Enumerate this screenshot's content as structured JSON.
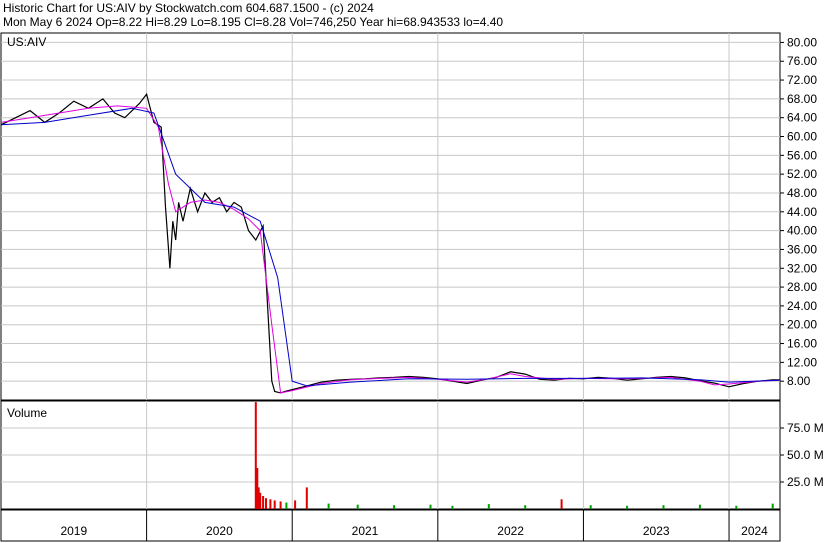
{
  "header": {
    "line1": "Historic Chart for US:AIV by Stockwatch.com 604.687.1500 - (c) 2024",
    "line2": "Mon May  6 2024   Op=8.22  Hi=8.29  Lo=8.195  Cl=8.28  Vol=746,250  Year hi=68.943533  lo=4.40"
  },
  "colors": {
    "price": "#000000",
    "ma_short": "#e000e0",
    "ma_long": "#0000cc",
    "volume_up": "#00a000",
    "volume_down": "#e00000",
    "grid": "#c8c8c8"
  },
  "chart_data": [
    {
      "type": "line",
      "label": "US:AIV",
      "y_ticks": [
        "80.00",
        "76.00",
        "72.00",
        "68.00",
        "64.00",
        "60.00",
        "56.00",
        "52.00",
        "48.00",
        "44.00",
        "40.00",
        "36.00",
        "32.00",
        "28.00",
        "24.00",
        "20.00",
        "16.00",
        "12.00",
        "8.00"
      ],
      "ylim": [
        4,
        82
      ],
      "x_labels": [
        "2019",
        "2020",
        "2021",
        "2022",
        "2023",
        "2024"
      ],
      "xlim": [
        2019.0,
        2024.35
      ],
      "grid": true,
      "series": [
        {
          "key": "close",
          "x": [
            2019.0,
            2019.1,
            2019.2,
            2019.3,
            2019.4,
            2019.5,
            2019.6,
            2019.7,
            2019.78,
            2019.85,
            2019.95,
            2020.0,
            2020.05,
            2020.1,
            2020.13,
            2020.16,
            2020.18,
            2020.2,
            2020.22,
            2020.25,
            2020.3,
            2020.35,
            2020.4,
            2020.45,
            2020.5,
            2020.55,
            2020.6,
            2020.65,
            2020.7,
            2020.75,
            2020.8,
            2020.86,
            2020.88,
            2020.92,
            2020.95,
            2021.0,
            2021.1,
            2021.2,
            2021.3,
            2021.4,
            2021.5,
            2021.6,
            2021.7,
            2021.8,
            2021.9,
            2022.0,
            2022.1,
            2022.2,
            2022.3,
            2022.4,
            2022.5,
            2022.6,
            2022.7,
            2022.8,
            2022.9,
            2023.0,
            2023.1,
            2023.2,
            2023.3,
            2023.4,
            2023.5,
            2023.6,
            2023.7,
            2023.8,
            2023.9,
            2024.0,
            2024.1,
            2024.2,
            2024.3,
            2024.35
          ],
          "y": [
            62.5,
            64.0,
            65.5,
            63.0,
            65.0,
            67.5,
            66.0,
            68.0,
            65.0,
            64.0,
            67.0,
            69.0,
            63.0,
            62.0,
            45.0,
            32.0,
            42.0,
            38.0,
            46.0,
            42.0,
            49.0,
            44.0,
            48.0,
            46.0,
            47.0,
            44.0,
            46.0,
            45.0,
            40.0,
            38.0,
            41.0,
            8.0,
            5.8,
            5.5,
            5.8,
            6.2,
            7.0,
            7.8,
            8.2,
            8.4,
            8.5,
            8.7,
            8.8,
            9.0,
            8.8,
            8.5,
            8.0,
            7.5,
            8.2,
            8.8,
            10.0,
            9.5,
            8.4,
            8.2,
            8.6,
            8.5,
            8.8,
            8.6,
            8.2,
            8.5,
            8.8,
            9.0,
            8.7,
            8.1,
            7.6,
            6.8,
            7.5,
            8.0,
            8.3,
            8.28
          ]
        },
        {
          "key": "ma_short",
          "x": [
            2019.0,
            2019.2,
            2019.4,
            2019.6,
            2019.8,
            2020.0,
            2020.08,
            2020.15,
            2020.2,
            2020.3,
            2020.4,
            2020.5,
            2020.6,
            2020.7,
            2020.78,
            2020.86,
            2020.92,
            2021.0,
            2021.2,
            2021.4,
            2021.6,
            2021.8,
            2022.0,
            2022.2,
            2022.35,
            2022.5,
            2022.6,
            2022.8,
            2023.0,
            2023.2,
            2023.4,
            2023.6,
            2023.8,
            2023.9,
            2024.0,
            2024.2,
            2024.35
          ],
          "y": [
            63.0,
            64.0,
            65.0,
            66.0,
            66.5,
            66.0,
            62.0,
            50.0,
            44.0,
            46.0,
            46.5,
            46.0,
            44.5,
            42.5,
            40.0,
            20.0,
            5.5,
            6.0,
            7.5,
            8.3,
            8.6,
            8.8,
            8.4,
            7.8,
            8.5,
            9.6,
            9.0,
            8.4,
            8.6,
            8.5,
            8.6,
            8.8,
            8.0,
            7.2,
            7.4,
            8.0,
            8.2
          ]
        },
        {
          "key": "ma_long",
          "x": [
            2019.0,
            2019.3,
            2019.6,
            2019.9,
            2020.05,
            2020.2,
            2020.4,
            2020.6,
            2020.78,
            2020.9,
            2021.0,
            2021.1,
            2021.4,
            2021.8,
            2022.2,
            2022.6,
            2023.0,
            2023.4,
            2023.8,
            2024.0,
            2024.35
          ],
          "y": [
            62.5,
            63.0,
            64.5,
            66.0,
            65.0,
            52.0,
            46.0,
            45.0,
            42.0,
            30.0,
            8.0,
            7.0,
            7.8,
            8.5,
            8.4,
            8.6,
            8.6,
            8.7,
            8.3,
            7.8,
            8.2
          ]
        }
      ]
    },
    {
      "type": "bar",
      "label": "Volume",
      "y_ticks": [
        "75.0 M",
        "50.0 M",
        "25.0 M"
      ],
      "ylim": [
        0,
        100
      ],
      "unit": "M",
      "series": [
        {
          "key": "volume",
          "x": [
            2020.75,
            2020.76,
            2020.77,
            2020.78,
            2020.8,
            2020.82,
            2020.85,
            2020.88,
            2020.92,
            2020.96,
            2021.02,
            2021.1,
            2021.25,
            2021.45,
            2021.7,
            2021.95,
            2022.1,
            2022.35,
            2022.6,
            2022.85,
            2023.05,
            2023.3,
            2023.55,
            2023.8,
            2024.05,
            2024.3
          ],
          "values": [
            99.0,
            38.0,
            20.0,
            15.0,
            12.0,
            10.0,
            9.0,
            8.0,
            7.0,
            6.0,
            8.0,
            20.0,
            5.0,
            4.0,
            3.5,
            4.0,
            3.0,
            4.5,
            3.5,
            9.0,
            3.5,
            3.0,
            3.5,
            4.0,
            3.0,
            5.0
          ]
        }
      ]
    }
  ]
}
